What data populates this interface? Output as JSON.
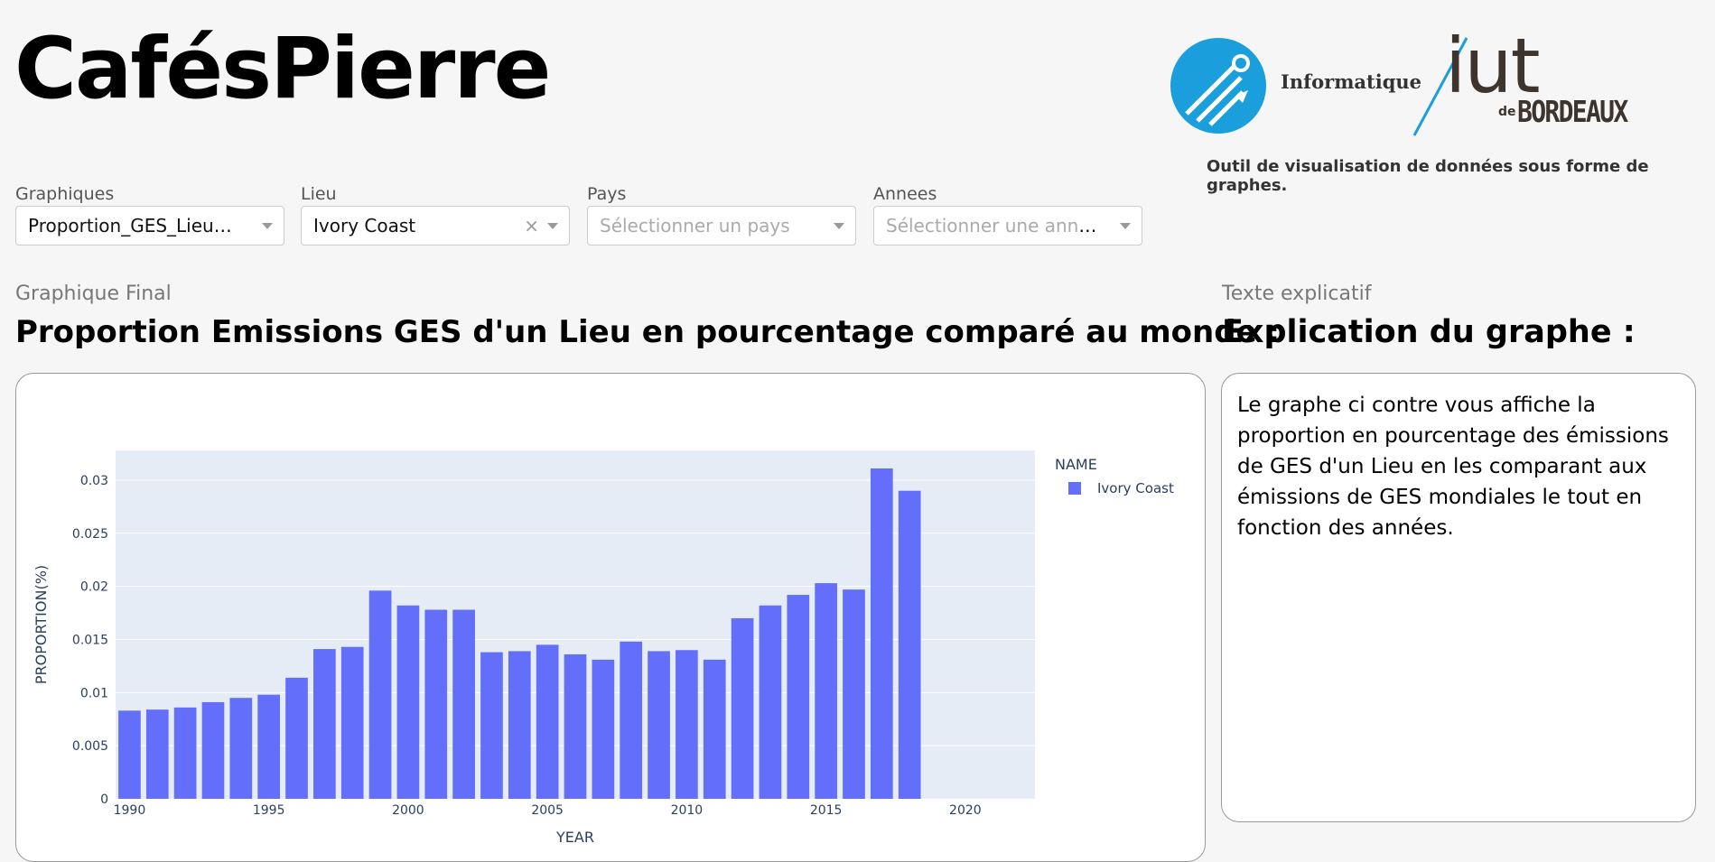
{
  "header": {
    "title": "CafésPierre",
    "logo_text": "Informatique",
    "logo_iut": "iut",
    "logo_de": "de",
    "logo_bordeaux": "BORDEAUX",
    "tagline": "Outil de visualisation de données sous forme de graphes."
  },
  "filters": {
    "graphiques": {
      "label": "Graphiques",
      "value": "Proportion_GES_Lieu_Monde"
    },
    "lieu": {
      "label": "Lieu",
      "value": "Ivory Coast",
      "clear": "×"
    },
    "pays": {
      "label": "Pays",
      "placeholder": "Sélectionner un pays"
    },
    "annees": {
      "label": "Annees",
      "placeholder": "Sélectionner une année"
    }
  },
  "graph_section": {
    "label": "Graphique Final",
    "heading": "Proportion Emissions GES d'un Lieu en pourcentage comparé au monde :"
  },
  "text_section": {
    "label": "Texte explicatif",
    "heading": "Explication du graphe :",
    "body": "Le graphe ci contre vous affiche la proportion en pourcentage des émissions de GES d'un Lieu en les comparant aux émissions de GES mondiales le tout en fonction des années."
  },
  "colors": {
    "bar": "#636efa",
    "plot_bg": "#e5ecf6",
    "axis_text": "#2a3f5f"
  },
  "chart_data": {
    "type": "bar",
    "title": "",
    "xlabel": "YEAR",
    "ylabel": "PROPORTION(%)",
    "legend_title": "NAME",
    "legend_position": "top-right",
    "grid": true,
    "x": [
      1990,
      1991,
      1992,
      1993,
      1994,
      1995,
      1996,
      1997,
      1998,
      1999,
      2000,
      2001,
      2002,
      2003,
      2004,
      2005,
      2006,
      2007,
      2008,
      2009,
      2010,
      2011,
      2012,
      2013,
      2014,
      2015,
      2016,
      2017,
      2018
    ],
    "series": [
      {
        "name": "Ivory Coast",
        "values": [
          0.0083,
          0.0084,
          0.0086,
          0.0091,
          0.0095,
          0.0098,
          0.0114,
          0.0141,
          0.0143,
          0.0196,
          0.0182,
          0.0178,
          0.0178,
          0.0138,
          0.0139,
          0.0145,
          0.0136,
          0.0131,
          0.0148,
          0.0139,
          0.014,
          0.0131,
          0.017,
          0.0182,
          0.0192,
          0.0203,
          0.0197,
          0.0311,
          0.029
        ]
      }
    ],
    "xlim": [
      1989.5,
      2022.5
    ],
    "ylim": [
      0,
      0.0328
    ],
    "xticks": [
      1990,
      1995,
      2000,
      2005,
      2010,
      2015,
      2020
    ],
    "yticks": [
      0,
      0.005,
      0.01,
      0.015,
      0.02,
      0.025,
      0.03
    ],
    "ytick_labels": [
      "0",
      "0.005",
      "0.01",
      "0.015",
      "0.02",
      "0.025",
      "0.03"
    ]
  }
}
